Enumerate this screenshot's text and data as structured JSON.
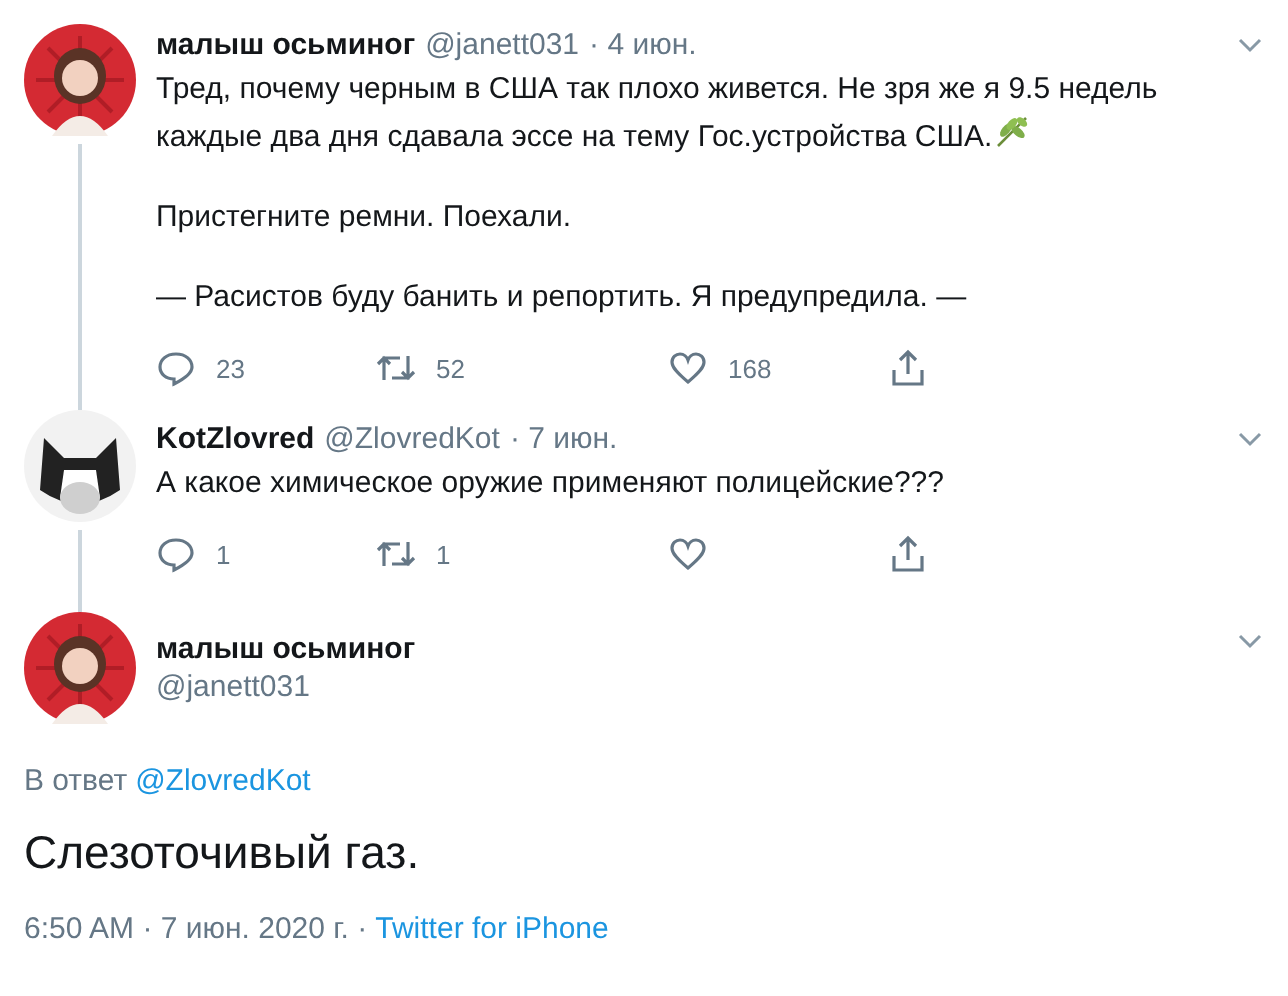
{
  "thread": [
    {
      "avatar": {
        "kind": "woman"
      },
      "name": "малыш осьминог",
      "handle": "@janett031",
      "date": "· 4 июн.",
      "paragraphs": [
        {
          "lines": [
            "Тред, почему черным в США так плохо живется. Не зря же я 9.5 недель",
            "каждые два дня сдавала эссе на тему Гос.устройства США."
          ],
          "emoji": {
            "kind": "herb"
          }
        },
        {
          "lines": [
            "Пристегните ремни. Поехали."
          ]
        },
        {
          "lines": [
            "— Расистов буду банить и репортить. Я предупредила. —"
          ]
        }
      ],
      "actions": [
        {
          "kind": "reply",
          "count": "23"
        },
        {
          "kind": "retweet",
          "count": "52"
        },
        {
          "kind": "like",
          "count": "168"
        },
        {
          "kind": "share"
        }
      ]
    },
    {
      "avatar": {
        "kind": "cat"
      },
      "name": "KotZlovred",
      "handle": "@ZlovredKot",
      "date": "· 7 июн.",
      "paragraphs": [
        {
          "lines": [
            "А какое химическое оружие применяют полицейские???"
          ]
        }
      ],
      "actions": [
        {
          "kind": "reply",
          "count": "1"
        },
        {
          "kind": "retweet",
          "count": "1"
        },
        {
          "kind": "like"
        },
        {
          "kind": "share"
        }
      ]
    }
  ],
  "focused": {
    "avatar": {
      "kind": "woman"
    },
    "name": "малыш осьминог",
    "handle": "@janett031",
    "reply_label": "В ответ",
    "reply_to": "@ZlovredKot",
    "text": "Слезоточивый газ.",
    "timestamp": "6:50 AM · 7 июн. 2020 г. ·",
    "source": "Twitter for iPhone"
  }
}
